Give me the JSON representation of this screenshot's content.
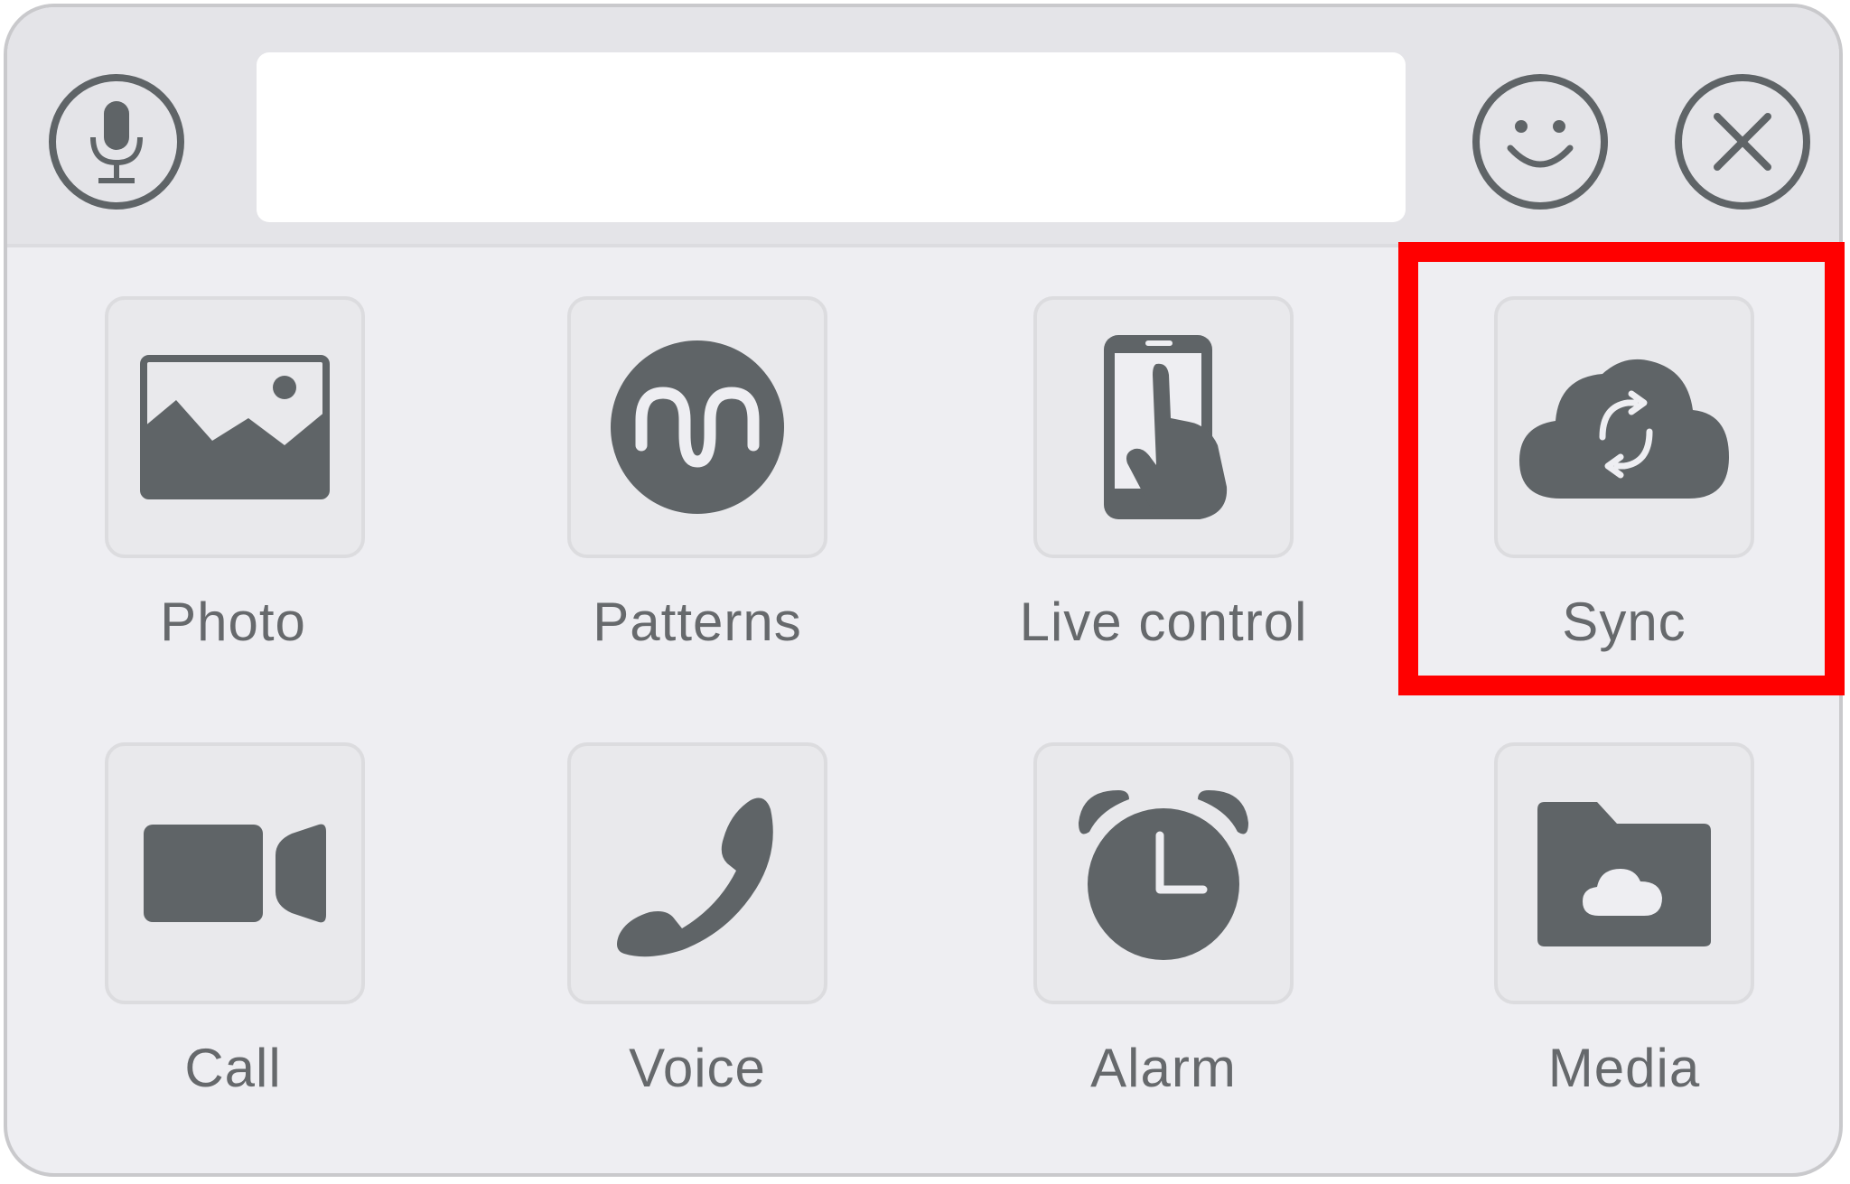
{
  "input": {
    "value": "",
    "placeholder": ""
  },
  "header": {
    "mic_icon": "microphone-icon",
    "emoji_icon": "smiley-icon",
    "close_icon": "close-icon"
  },
  "items": [
    {
      "label": "Photo",
      "icon": "image-icon"
    },
    {
      "label": "Patterns",
      "icon": "wave-pattern-icon"
    },
    {
      "label": "Live control",
      "icon": "phone-touch-icon"
    },
    {
      "label": "Sync",
      "icon": "cloud-sync-icon"
    },
    {
      "label": "Call",
      "icon": "video-camera-icon"
    },
    {
      "label": "Voice",
      "icon": "phone-handset-icon"
    },
    {
      "label": "Alarm",
      "icon": "alarm-clock-icon"
    },
    {
      "label": "Media",
      "icon": "cloud-folder-icon"
    }
  ],
  "highlighted_item": "Sync",
  "colors": {
    "icon": "#5f6467",
    "highlight": "#ff0000",
    "panel_bg": "#eeeef2",
    "topbar_bg": "#e4e4e8"
  }
}
